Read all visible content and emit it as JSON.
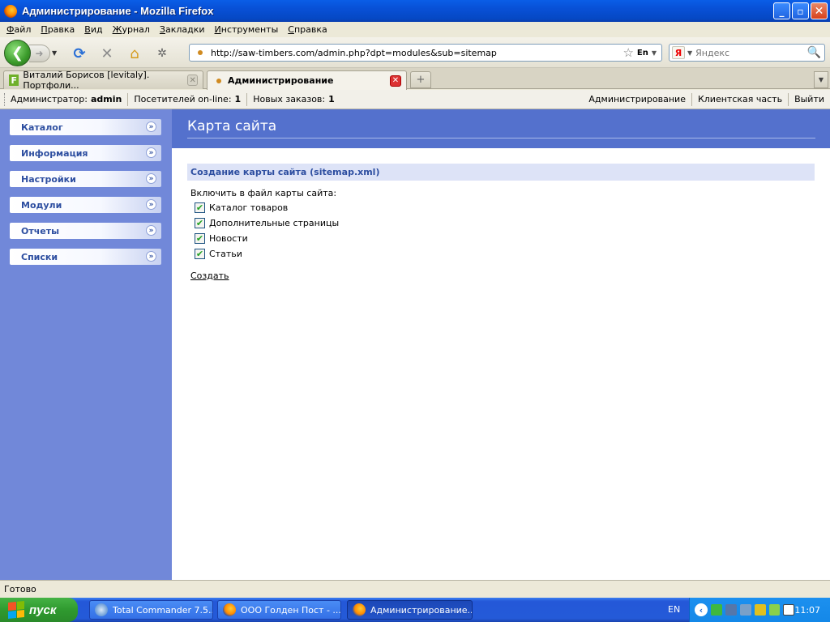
{
  "window": {
    "title": "Администрирование - Mozilla Firefox",
    "minimize": "_",
    "maximize": "▫",
    "close": "✕"
  },
  "menu": [
    "Файл",
    "Правка",
    "Вид",
    "Журнал",
    "Закладки",
    "Инструменты",
    "Справка"
  ],
  "toolbar": {
    "url": "http://saw-timbers.com/admin.php?dpt=modules&sub=sitemap",
    "lang_indicator": "En",
    "search_placeholder": "Яндекс",
    "search_engine_letter": "Я"
  },
  "tabs": [
    {
      "favicon": "F",
      "label": "Виталий Борисов [levitaly]. Портфоли...",
      "active": false
    },
    {
      "label": "Администрирование",
      "active": true
    }
  ],
  "adminbar": {
    "admin_label": "Администратор:",
    "admin_value": "admin",
    "visitors_label": "Посетителей on-line:",
    "visitors_value": "1",
    "orders_label": "Новых заказов:",
    "orders_value": "1",
    "links": [
      "Администрирование",
      "Клиентская часть",
      "Выйти"
    ]
  },
  "sidebar": {
    "items": [
      "Каталог",
      "Информация",
      "Настройки",
      "Модули",
      "Отчеты",
      "Списки"
    ]
  },
  "page": {
    "title": "Карта сайта",
    "section_title": "Создание карты сайта (sitemap.xml)",
    "include_label": "Включить в файл карты сайта:",
    "options": [
      {
        "label": "Каталог товаров",
        "checked": true
      },
      {
        "label": "Дополнительные страницы",
        "checked": true
      },
      {
        "label": "Новости",
        "checked": true
      },
      {
        "label": "Статьи",
        "checked": true
      }
    ],
    "create_link": "Создать"
  },
  "status": "Готово",
  "taskbar": {
    "start": "пуск",
    "tasks": [
      {
        "label": "Total Commander 7.5...",
        "active": false
      },
      {
        "label": "ООО Голден Пост - ...",
        "active": false
      },
      {
        "label": "Администрирование...",
        "active": true
      }
    ],
    "lang": "EN",
    "clock": "11:07"
  },
  "colors": {
    "sidebar_bg": "#7188d9",
    "header_bg": "#5471cd",
    "section_bg": "#dde3f7",
    "accent_text": "#2d4ea0"
  }
}
